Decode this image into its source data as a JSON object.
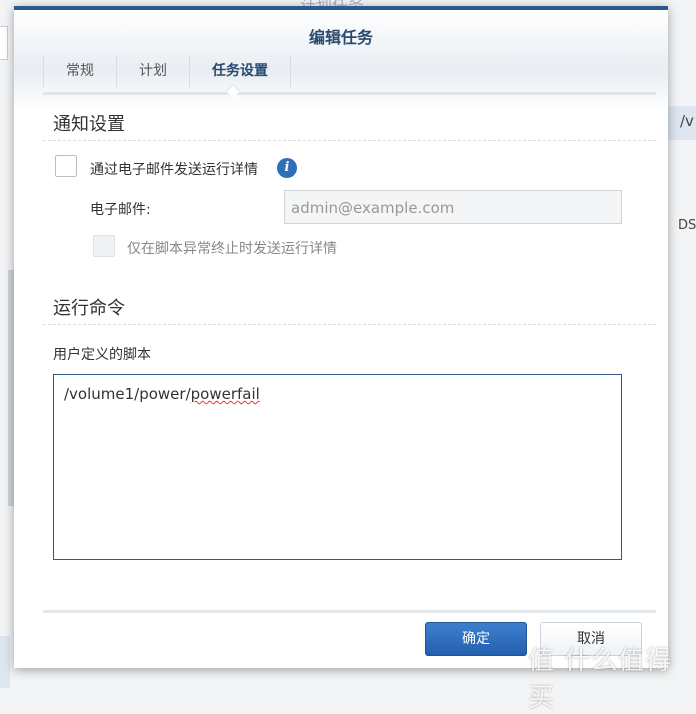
{
  "background": {
    "title": "计划任务",
    "right_text_1": "/v",
    "right_text_2": "DS"
  },
  "dialog": {
    "title": "编辑任务",
    "tabs": [
      {
        "label": "常规"
      },
      {
        "label": "计划"
      },
      {
        "label": "任务设置",
        "active": true
      }
    ],
    "notify": {
      "section_title": "通知设置",
      "email_checkbox_label": "通过电子邮件发送运行详情",
      "email_checkbox_checked": false,
      "email_label": "电子邮件:",
      "email_placeholder": "admin@example.com",
      "abnormal_label": "仅在脚本异常终止时发送运行详情",
      "abnormal_checked": false
    },
    "command": {
      "section_title": "运行命令",
      "script_label": "用户定义的脚本",
      "script_prefix": "/volume1/power/",
      "script_misspelled": "powerfail"
    },
    "ok_label": "确定",
    "cancel_label": "取消"
  },
  "watermark": "值 什么值得买",
  "colors": {
    "accent": "#2c5a8c",
    "primary_button": "#2f6fbf"
  }
}
